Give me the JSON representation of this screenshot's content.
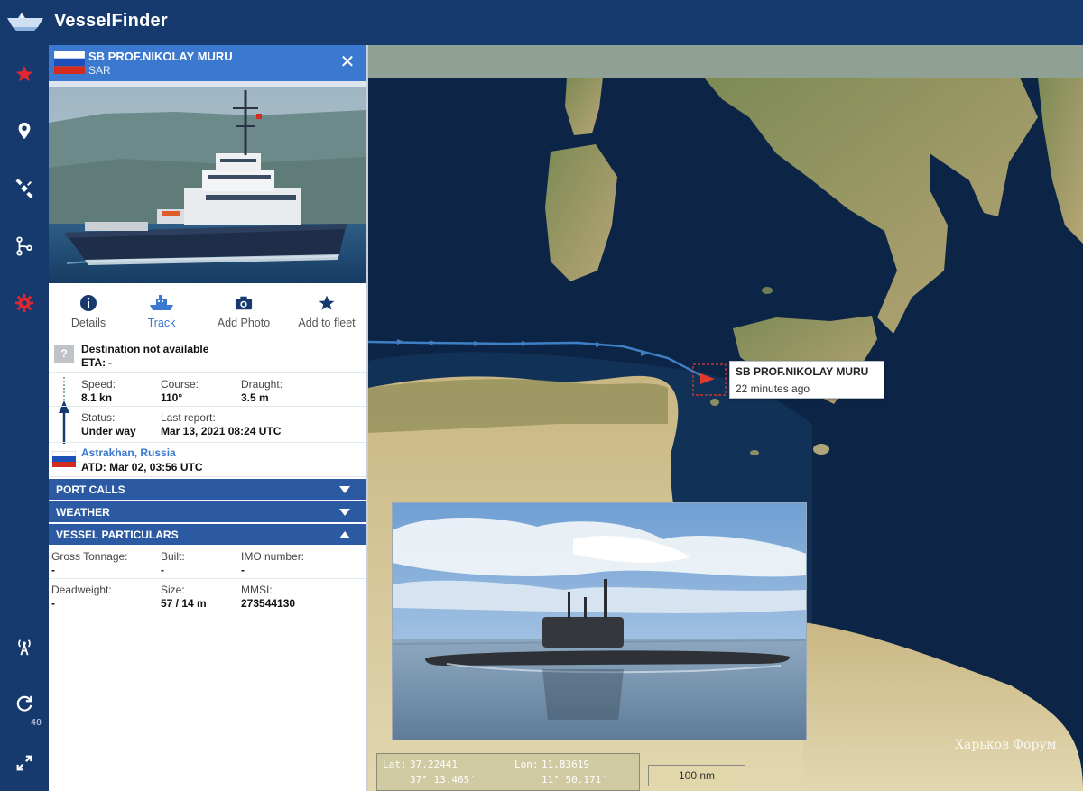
{
  "app": {
    "brand": "VesselFinder"
  },
  "rail": {
    "counter": "40",
    "items": [
      {
        "icon": "star-icon"
      },
      {
        "icon": "map-pin-icon"
      },
      {
        "icon": "satellite-icon"
      },
      {
        "icon": "route-icon"
      },
      {
        "icon": "settings-icon"
      },
      {
        "icon": "antenna-icon"
      },
      {
        "icon": "refresh-icon"
      },
      {
        "icon": "fullscreen-icon"
      }
    ]
  },
  "vessel": {
    "name": "SB PROF.NIKOLAY MURU",
    "type": "SAR",
    "flag": "Russia",
    "actions": [
      {
        "label": "Details",
        "icon": "info-icon"
      },
      {
        "label": "Track",
        "icon": "ship-icon"
      },
      {
        "label": "Add Photo",
        "icon": "camera-icon"
      },
      {
        "label": "Add to fleet",
        "icon": "star-icon"
      }
    ],
    "destination": "Destination not available",
    "destination_q": "?",
    "eta_label": "ETA:",
    "eta_value": "-",
    "speed_label": "Speed:",
    "speed_value": "8.1 kn",
    "course_label": "Course:",
    "course_value": "110°",
    "draught_label": "Draught:",
    "draught_value": "3.5 m",
    "status_label": "Status:",
    "status_value": "Under way",
    "last_report_label": "Last report:",
    "last_report_value": "Mar 13, 2021 08:24 UTC",
    "departure_port": "Astrakhan, Russia",
    "atd": "ATD: Mar 02, 03:56 UTC"
  },
  "sections": {
    "port_calls": "PORT CALLS",
    "weather": "WEATHER",
    "particulars": "VESSEL PARTICULARS"
  },
  "particulars": {
    "gross_tonnage_label": "Gross Tonnage:",
    "gross_tonnage_value": "-",
    "built_label": "Built:",
    "built_value": "-",
    "imo_label": "IMO number:",
    "imo_value": "-",
    "deadweight_label": "Deadweight:",
    "deadweight_value": "-",
    "size_label": "Size:",
    "size_value": "57 / 14 m",
    "mmsi_label": "MMSI:",
    "mmsi_value": "273544130"
  },
  "map": {
    "callout_name": "SB PROF.NIKOLAY MURU",
    "callout_time": "22 minutes ago",
    "lat_label": "Lat:",
    "lat_value": "37.22441",
    "lat_dms": "37° 13.465′",
    "lon_label": "Lon:",
    "lon_value": "11.83619",
    "lon_dms": "11° 50.171′",
    "scale": "100 nm",
    "watermark": "Харьков Форум"
  },
  "colors": {
    "topbar": "#163a6e",
    "accent": "#3b78d0",
    "section": "#2b5aa3",
    "sea": "#0c2445",
    "track": "#3f7fc4",
    "marker": "#e23b2e"
  }
}
